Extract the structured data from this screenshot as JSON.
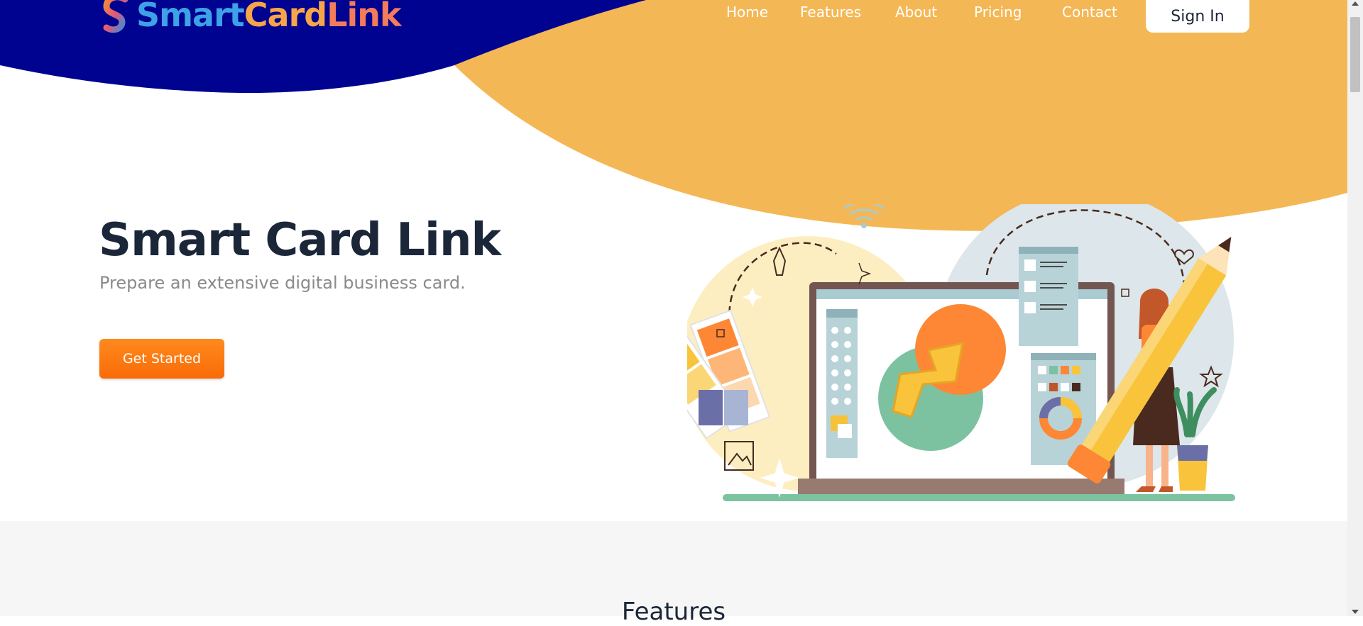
{
  "brand": {
    "smart": "Smart",
    "card": "Card",
    "link": "Link"
  },
  "nav": {
    "items": [
      {
        "label": "Home"
      },
      {
        "label": "Features"
      },
      {
        "label": "About"
      },
      {
        "label": "Pricing"
      },
      {
        "label": "Contact"
      }
    ],
    "signin": "Sign In"
  },
  "hero": {
    "title": "Smart Card Link",
    "subtitle": "Prepare an extensive digital business card.",
    "cta": "Get Started"
  },
  "features": {
    "title": "Features"
  },
  "colors": {
    "navy": "#000290",
    "orange_wave": "#f4b755",
    "cta": "#fb7a10",
    "text_dark": "#1b2638",
    "text_muted": "#8a8a8a"
  },
  "icons": [
    "logo-s-icon",
    "illustration",
    "scroll-up-icon",
    "scroll-down-icon"
  ]
}
